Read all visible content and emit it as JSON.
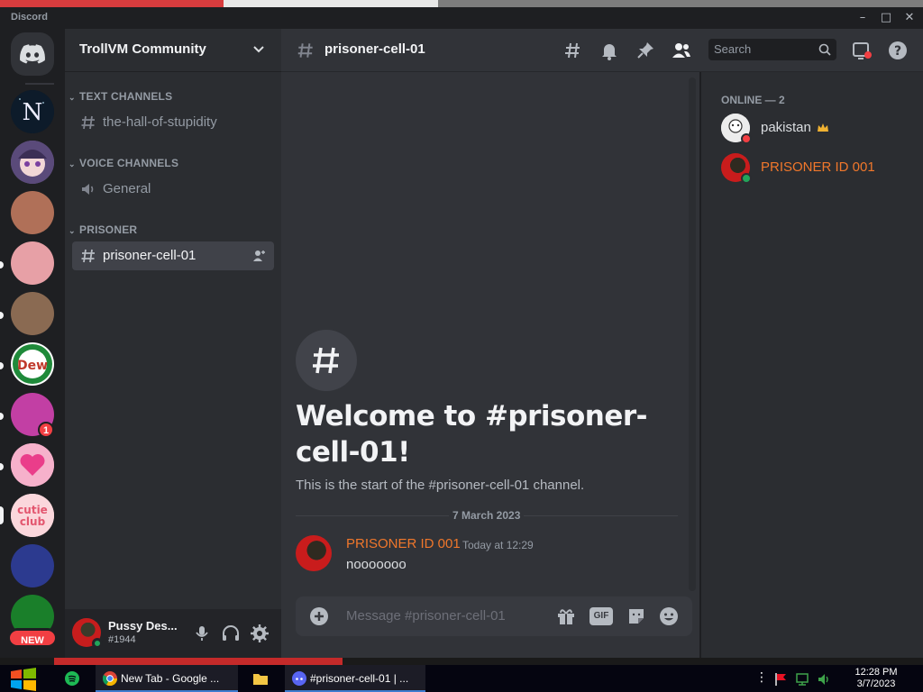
{
  "window": {
    "app_name": "Discord",
    "controls": [
      "–",
      "□",
      "✕"
    ]
  },
  "guild": {
    "name": "TrollVM Community"
  },
  "rail": {
    "new_label": "NEW",
    "unread_badge": "1"
  },
  "sidebar": {
    "categories": [
      {
        "name": "TEXT CHANNELS",
        "channels": [
          {
            "label": "the-hall-of-stupidity",
            "type": "text"
          }
        ]
      },
      {
        "name": "VOICE CHANNELS",
        "channels": [
          {
            "label": "General",
            "type": "voice"
          }
        ]
      },
      {
        "name": "PRISONER",
        "channels": [
          {
            "label": "prisoner-cell-01",
            "type": "text",
            "active": true
          }
        ]
      }
    ]
  },
  "user_panel": {
    "name": "Pussy Des...",
    "tag": "#1944"
  },
  "header": {
    "channel": "prisoner-cell-01",
    "search_placeholder": "Search"
  },
  "chat": {
    "welcome_title": "Welcome to #prisoner-cell-01!",
    "welcome_sub": "This is the start of the #prisoner-cell-01 channel.",
    "date_divider": "7 March 2023",
    "messages": [
      {
        "author": "PRISONER ID 001",
        "timestamp": "Today at 12:29",
        "content": "nooooooo"
      }
    ],
    "composer_placeholder": "Message #prisoner-cell-01",
    "gif_label": "GIF"
  },
  "members": {
    "category": "ONLINE — 2",
    "list": [
      {
        "name": "pakistan",
        "status": "dnd",
        "color": "#dbdee1",
        "crown": true
      },
      {
        "name": "PRISONER ID 001",
        "status": "online",
        "color": "#f0772b",
        "crown": false
      }
    ]
  },
  "taskbar": {
    "items": [
      {
        "label": "New Tab - Google ...",
        "icon": "chrome-icon"
      },
      {
        "label": "#prisoner-cell-01 | ...",
        "icon": "discord-icon"
      }
    ],
    "clock_time": "12:28 PM",
    "clock_date": "3/7/2023"
  },
  "colors": {
    "blurple": "#5865f2",
    "online": "#23a55a",
    "dnd": "#f23f43",
    "author_orange": "#f0772b"
  }
}
